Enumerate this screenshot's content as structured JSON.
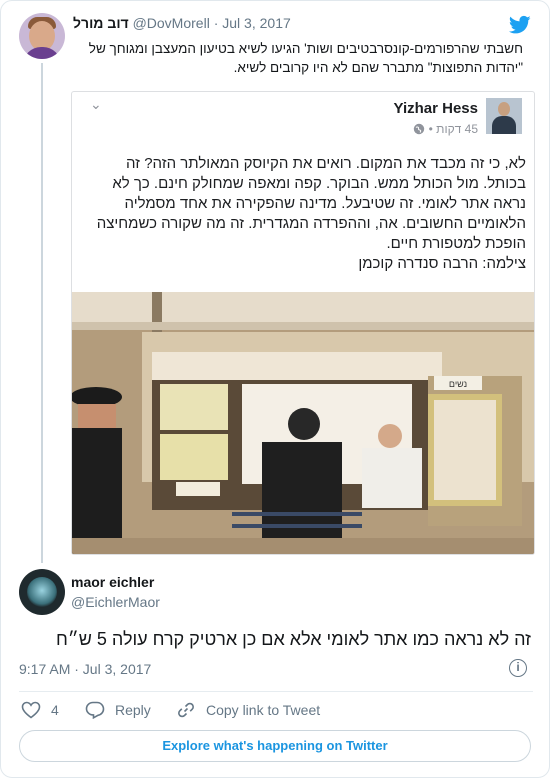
{
  "parent_tweet": {
    "display_name": "דוב מורל",
    "handle": "@DovMorell",
    "separator": "·",
    "date": "Jul 3, 2017",
    "text": "חשבתי שהרפורמים-קונסרבטיבים ושות' הגיעו לשיא בטיעון המעצבן ומגוחך של \"יהדות התפוצות\" מתברר שהם לא היו קרובים לשיא."
  },
  "quoted_post": {
    "author": "Yizhar Hess",
    "time_ago": "45 דקות",
    "separator": "•",
    "text": "לא, כי זה מכבד את המקום. רואים את הקיוסק המאולתר הזה? זה בכותל. מול הכותל ממש. הבוקר. קפה ומאפה שמחולק חינם. כך לא נראה אתר לאומי. זה שטיבעל. מדינה שהפקירה את אחד מסמליה הלאומיים החשובים. אה, וההפרדה המגדרית. זה מה שקורה כשמחיצה הופכת למטפורת חיים.",
    "credit": "צילמה: הרבה סנדרה קוכמן",
    "photo_sign": "נשים"
  },
  "reply_tweet": {
    "display_name": "maor eichler",
    "handle": "@EichlerMaor",
    "text": "זה לא נראה כמו אתר לאומי אלא אם כן ארטיק קרח עולה 5 ש״ח",
    "timestamp": "9:17 AM · Jul 3, 2017"
  },
  "actions": {
    "like_count": "4",
    "reply_label": "Reply",
    "copy_link_label": "Copy link to Tweet"
  },
  "explore_label": "Explore what's happening on Twitter",
  "colors": {
    "twitter_blue": "#1da1f2",
    "link_blue": "#1b95e0",
    "muted": "#657786"
  }
}
